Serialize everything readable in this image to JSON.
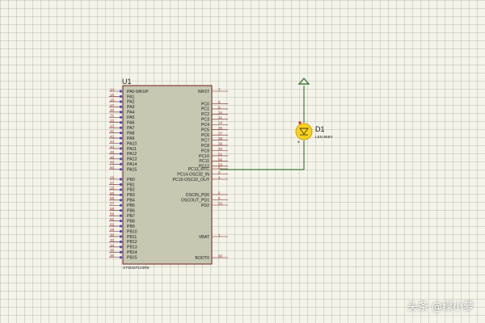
{
  "colors": {
    "background": "#f4f4ea",
    "ic_fill": "#c7c8b2",
    "ic_border": "#7a1c1c",
    "wire": "#1f6a1f",
    "pin_line": "#7a1c1c",
    "led_fill": "#ffd21a",
    "led_outline": "#c9a000",
    "pin_dot_blue": "#2f4fd0",
    "pin_dot_red": "#d02020"
  },
  "ic": {
    "ref": "U1",
    "part": "STM32F103R6",
    "left_pins": [
      {
        "num": "14",
        "label": "PA0-WKUP"
      },
      {
        "num": "15",
        "label": "PA1"
      },
      {
        "num": "16",
        "label": "PA2"
      },
      {
        "num": "17",
        "label": "PA3"
      },
      {
        "num": "20",
        "label": "PA4"
      },
      {
        "num": "21",
        "label": "PA5"
      },
      {
        "num": "22",
        "label": "PA6"
      },
      {
        "num": "23",
        "label": "PA7"
      },
      {
        "num": "41",
        "label": "PA8"
      },
      {
        "num": "42",
        "label": "PA9"
      },
      {
        "num": "43",
        "label": "PA10"
      },
      {
        "num": "44",
        "label": "PA11"
      },
      {
        "num": "45",
        "label": "PA12"
      },
      {
        "num": "46",
        "label": "PA13"
      },
      {
        "num": "49",
        "label": "PA14"
      },
      {
        "num": "50",
        "label": "PA15"
      },
      {
        "num": "26",
        "label": "PB0"
      },
      {
        "num": "27",
        "label": "PB1"
      },
      {
        "num": "28",
        "label": "PB2"
      },
      {
        "num": "55",
        "label": "PB3"
      },
      {
        "num": "56",
        "label": "PB4"
      },
      {
        "num": "57",
        "label": "PB5"
      },
      {
        "num": "58",
        "label": "PB6"
      },
      {
        "num": "59",
        "label": "PB7"
      },
      {
        "num": "61",
        "label": "PB8"
      },
      {
        "num": "62",
        "label": "PB9"
      },
      {
        "num": "29",
        "label": "PB10"
      },
      {
        "num": "30",
        "label": "PB11"
      },
      {
        "num": "33",
        "label": "PB12"
      },
      {
        "num": "34",
        "label": "PB13"
      },
      {
        "num": "35",
        "label": "PB14"
      },
      {
        "num": "36",
        "label": "PB15"
      }
    ],
    "right_pins": [
      {
        "num": "7",
        "label": "NRST"
      },
      {
        "num": "8",
        "label": "PC0"
      },
      {
        "num": "9",
        "label": "PC1"
      },
      {
        "num": "10",
        "label": "PC2"
      },
      {
        "num": "11",
        "label": "PC3"
      },
      {
        "num": "24",
        "label": "PC4"
      },
      {
        "num": "25",
        "label": "PC5"
      },
      {
        "num": "37",
        "label": "PC6"
      },
      {
        "num": "38",
        "label": "PC7"
      },
      {
        "num": "39",
        "label": "PC8"
      },
      {
        "num": "40",
        "label": "PC9"
      },
      {
        "num": "51",
        "label": "PC10"
      },
      {
        "num": "52",
        "label": "PC11"
      },
      {
        "num": "53",
        "label": "PC12"
      },
      {
        "num": "2",
        "label": "PC13_RTC"
      },
      {
        "num": "3",
        "label": "PC14-OSC32_IN"
      },
      {
        "num": "4",
        "label": "PC15-OSC32_OUT"
      },
      {
        "num": "5",
        "label": "OSCIN_PD0"
      },
      {
        "num": "6",
        "label": "OSCOUT_PD1"
      },
      {
        "num": "54",
        "label": "PD2"
      },
      {
        "num": "1",
        "label": "VBAT"
      },
      {
        "num": "60",
        "label": "BOOT0"
      }
    ]
  },
  "led": {
    "ref": "D1",
    "part": "LED-BIBY"
  },
  "watermark": "头条 @绿小萝"
}
